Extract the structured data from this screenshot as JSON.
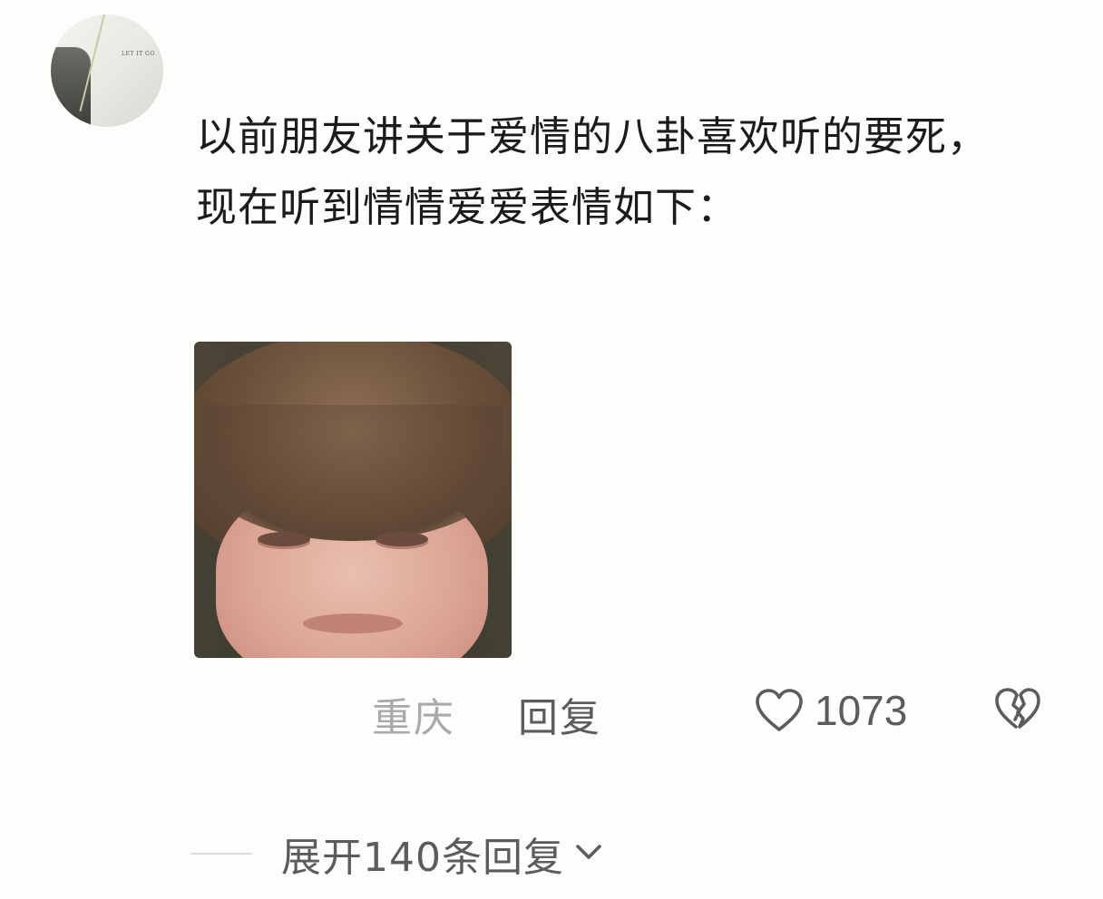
{
  "avatar": {
    "badge_text": "LET IT GO"
  },
  "comment": {
    "text": "以前朋友讲关于爱情的八卦喜欢听的要死，现在听到情情爱爱表情如下："
  },
  "attachment": {
    "icon": "photo"
  },
  "actions": {
    "location": "重庆",
    "reply_label": "回复",
    "like_icon": "heart-outline-icon",
    "like_count": "1073",
    "dislike_icon": "broken-heart-icon"
  },
  "expand": {
    "label": "展开140条回复",
    "icon": "chevron-down-icon"
  }
}
